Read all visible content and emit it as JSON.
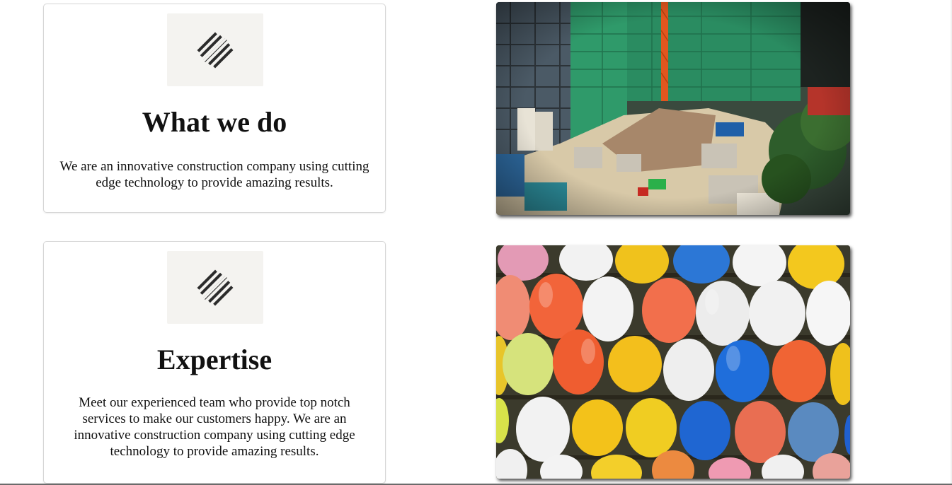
{
  "sections": [
    {
      "title": "What we do",
      "body": "We are an innovative construction company using cutting edge technology to provide amazing results.",
      "logo_icon": "diagonal-stripes-logo",
      "image_subject": "construction-site-photo"
    },
    {
      "title": "Expertise",
      "body": "Meet our experienced team who provide top notch services to make our customers happy. We are an innovative construction company using cutting edge technology to provide amazing results.",
      "logo_icon": "diagonal-stripes-logo",
      "image_subject": "hard-hats-photo"
    }
  ],
  "colors": {
    "card_border": "#d6d6d6",
    "logo_background": "#f4f3f0",
    "text": "#111111"
  }
}
